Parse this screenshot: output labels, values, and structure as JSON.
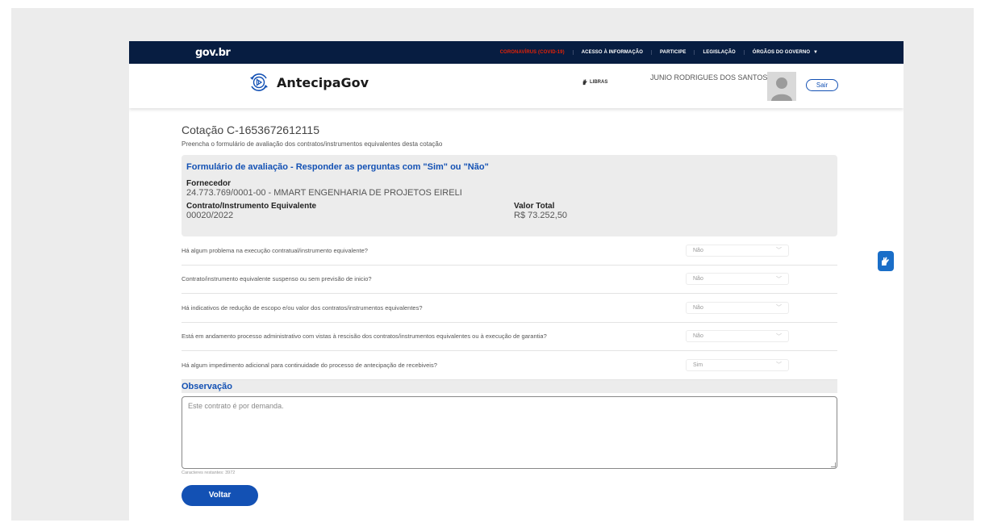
{
  "gov": {
    "logo": "gov.br",
    "links": [
      {
        "label": "CORONAVÍRUS (COVID-19)",
        "kind": "covid"
      },
      {
        "label": "ACESSO À INFORMAÇÃO",
        "kind": "normal"
      },
      {
        "label": "PARTICIPE",
        "kind": "normal"
      },
      {
        "label": "LEGISLAÇÃO",
        "kind": "normal"
      },
      {
        "label": "ÓRGÃOS DO GOVERNO",
        "kind": "normal"
      }
    ],
    "dropdown_arrow": "▼"
  },
  "header": {
    "app_name": "AntecipaGov",
    "libras": "LIBRAS",
    "user_name": "JUNIO RODRIGUES DOS SANTOS",
    "logout": "Sair"
  },
  "page": {
    "title": "Cotação C-1653672612115",
    "subtitle": "Preencha o formulário de avaliação dos contratos/instrumentos equivalentes desta cotação"
  },
  "form": {
    "title": "Formulário de avaliação - Responder  as perguntas com \"Sim\" ou \"Não\"",
    "supplier_label": "Fornecedor",
    "supplier_value": "24.773.769/0001-00 - MMART ENGENHARIA DE PROJETOS EIRELI",
    "contract_label": "Contrato/Instrumento Equivalente",
    "contract_value": "00020/2022",
    "total_label": "Valor Total",
    "total_value": "R$ 73.252,50"
  },
  "questions": [
    {
      "text": "Há algum problema na execução contratual/instrumento equivalente?",
      "answer": "Não"
    },
    {
      "text": "Contrato/instrumento equivalente suspenso ou sem previsão de inicio?",
      "answer": "Não"
    },
    {
      "text": "Há indicativos de redução de escopo e/ou valor dos contratos/instrumentos equivalentes?",
      "answer": "Não"
    },
    {
      "text": "Está em andamento processo administrativo com vistas à rescisão dos contratos/instrumentos equivalentes ou à execução de garantia?",
      "answer": "Não"
    },
    {
      "text": "Há algum impedimento adicional para continuidade do processo de antecipação de recebiveis?",
      "answer": "Sim"
    }
  ],
  "observation": {
    "label": "Observação",
    "value": "Este contrato é por demanda.",
    "chars_remaining": "Caracteres restantes: 3972"
  },
  "actions": {
    "back": "Voltar"
  },
  "colors": {
    "gov_bar": "#071d41",
    "primary": "#1351b4",
    "covid": "#e52207"
  }
}
